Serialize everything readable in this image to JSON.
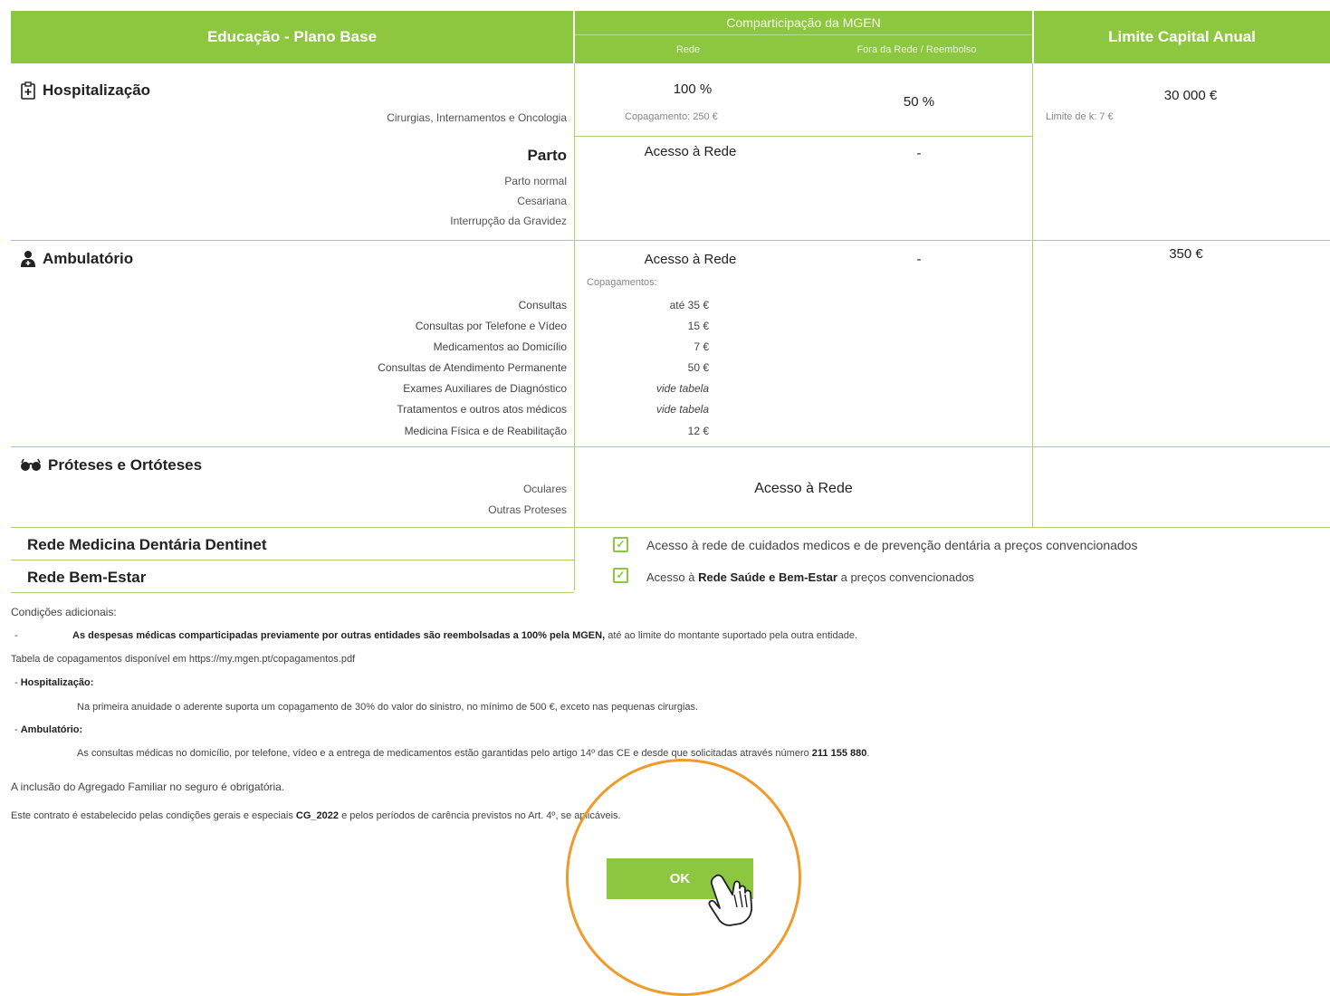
{
  "header": {
    "col1": "Educação - Plano Base",
    "col2": "Comparticipação da MGEN",
    "col2_sub_network": "Rede",
    "col2_sub_outside": "Fora da Rede / Reembolso",
    "col3": "Limite Capital Anual"
  },
  "hospitalizacao": {
    "title": "Hospitalização",
    "subtitle": "Cirurgias, Internamentos e Oncologia",
    "network_value": "100 %",
    "network_copay": "Copagamento: 250 €",
    "outside_value": "50 %",
    "limit_value": "30 000 €",
    "limit_note": "Limite de k: 7 €",
    "parto": {
      "title": "Parto",
      "items": [
        "Parto normal",
        "Cesariana",
        "Interrupção da Gravidez"
      ],
      "network_value": "Acesso à Rede",
      "outside_value": "-"
    }
  },
  "ambulatorio": {
    "title": "Ambulatório",
    "network_value": "Acesso à Rede",
    "outside_value": "-",
    "limit_value": "350 €",
    "copay_label": "Copagamentos:",
    "rows": [
      {
        "label": "Consultas",
        "value": "até 35 €"
      },
      {
        "label": "Consultas por Telefone e Vídeo",
        "value": "15 €"
      },
      {
        "label": "Medicamentos ao Domicílio",
        "value": "7 €"
      },
      {
        "label": "Consultas de Atendimento Permanente",
        "value": "50 €"
      },
      {
        "label": "Exames Auxiliares de Diagnóstico",
        "value": "vide tabela"
      },
      {
        "label": "Tratamentos e outros atos médicos",
        "value": "vide tabela"
      },
      {
        "label": "Medicina Física e de Reabilitação",
        "value": "12 €"
      }
    ]
  },
  "proteses": {
    "title": "Próteses e Ortóteses",
    "items": [
      "Oculares",
      "Outras Proteses"
    ],
    "network_value": "Acesso à Rede"
  },
  "dentinet": {
    "title": "Rede Medicina Dentária Dentinet",
    "text": "Acesso à rede de cuidados medicos e de prevenção dentária a preços convencionados"
  },
  "bemestar": {
    "title": "Rede Bem-Estar",
    "text_pre": "Acesso à ",
    "text_bold": "Rede Saúde e Bem-Estar",
    "text_post": " a preços convencionados"
  },
  "conditions": {
    "heading": "Condições adicionais:",
    "dash": "-",
    "line1_bold": "As despesas médicas comparticipadas previamente por outras entidades são reembolsadas a 100% pela MGEN,",
    "line1_rest": " até ao limite do montante suportado pela outra entidade.",
    "line2": "Tabela de copagamentos disponível em https://my.mgen.pt/copagamentos.pdf",
    "hosp_heading": "Hospitalização:",
    "hosp_text": "Na primeira anuidade o aderente suporta um copagamento de 30% do valor do sinistro, no mínimo de 500 €, exceto nas pequenas cirurgias.",
    "amb_heading": "Ambulatório:",
    "amb_text": "As consultas médicas no domicílio, por telefone, vídeo e a entrega de medicamentos estão garantidas pelo artigo 14º das CE e desde que solicitadas através número ",
    "amb_phone": "211 155 880",
    "amb_end": ".",
    "family": "A inclusão do Agregado Familiar no seguro é obrigatória.",
    "contract_pre": "Este contrato é estabelecido pelas condições gerais e especiais ",
    "contract_bold": "CG_2022",
    "contract_post": " e pelos períodos de carência previstos no Art. 4º, se aplicáveis."
  },
  "ok_button": "OK",
  "colors": {
    "accent": "#8dc63f",
    "highlight_ring": "#f09a2c"
  },
  "icons": [
    "hospital-icon",
    "doctor-icon",
    "glasses-icon",
    "check-icon",
    "hand-pointer-icon"
  ]
}
